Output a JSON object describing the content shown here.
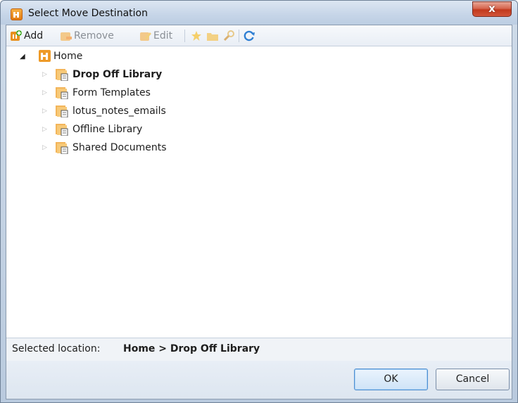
{
  "window": {
    "title": "Select Move Destination",
    "close_glyph": "x"
  },
  "toolbar": {
    "add_label": "Add",
    "remove_label": "Remove",
    "edit_label": "Edit",
    "icons": [
      "add-icon",
      "remove-icon",
      "edit-icon",
      "favorite-star-icon",
      "folder-icon",
      "find-icon",
      "refresh-icon"
    ]
  },
  "tree": {
    "root": {
      "label": "Home",
      "expanded": true,
      "icon": "site-home-icon"
    },
    "children": [
      {
        "label": "Drop Off Library",
        "selected": true,
        "icon": "document-library-icon"
      },
      {
        "label": "Form Templates",
        "selected": false,
        "icon": "document-library-icon"
      },
      {
        "label": "lotus_notes_emails",
        "selected": false,
        "icon": "document-library-icon"
      },
      {
        "label": "Offline Library",
        "selected": false,
        "icon": "document-library-icon"
      },
      {
        "label": "Shared Documents",
        "selected": false,
        "icon": "document-library-icon"
      }
    ]
  },
  "status": {
    "label": "Selected location:",
    "value": "Home > Drop Off Library"
  },
  "footer": {
    "ok_label": "OK",
    "cancel_label": "Cancel"
  },
  "colors": {
    "accent_orange": "#f0a030",
    "titlebar": "#c6d5e8",
    "close_red": "#c2391d"
  }
}
